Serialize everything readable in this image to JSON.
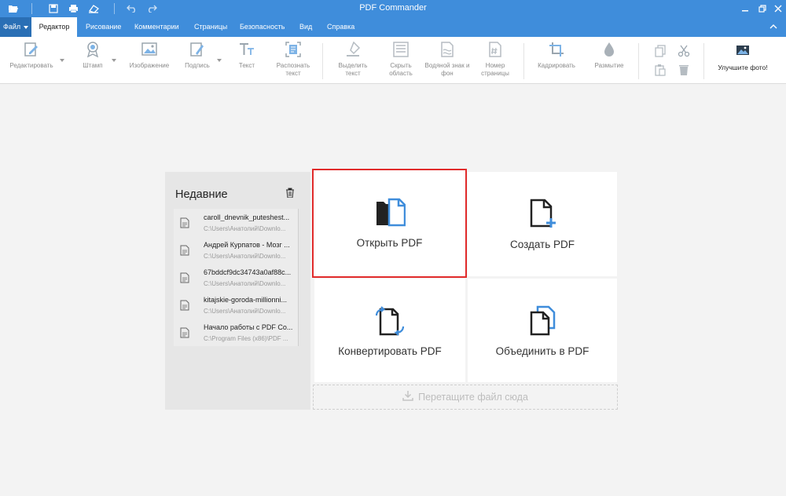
{
  "window": {
    "title": "PDF Commander"
  },
  "menu": {
    "items": [
      {
        "label": "Файл"
      },
      {
        "label": "Редактор"
      },
      {
        "label": "Рисование"
      },
      {
        "label": "Комментарии"
      },
      {
        "label": "Страницы"
      },
      {
        "label": "Безопасность"
      },
      {
        "label": "Вид"
      },
      {
        "label": "Справка"
      }
    ],
    "active": "Редактор"
  },
  "toolbar": {
    "tools": [
      {
        "label": "Редактировать",
        "icon": "edit-icon"
      },
      {
        "label": "Штамп",
        "icon": "stamp-icon"
      },
      {
        "label": "Изображение",
        "icon": "image-icon"
      },
      {
        "label": "Подпись",
        "icon": "signature-icon"
      },
      {
        "label": "Текст",
        "icon": "text-icon"
      },
      {
        "label": "Распознать текст",
        "icon": "ocr-icon"
      },
      {
        "label": "Выделить текст",
        "icon": "highlight-icon"
      },
      {
        "label": "Скрыть область",
        "icon": "hide-area-icon"
      },
      {
        "label": "Водяной знак и фон",
        "icon": "watermark-icon"
      },
      {
        "label": "Номер страницы",
        "icon": "page-number-icon"
      },
      {
        "label": "Кадрировать",
        "icon": "crop-icon"
      },
      {
        "label": "Размытие",
        "icon": "blur-icon"
      }
    ],
    "improve_label": "Улучшите фото!"
  },
  "recent": {
    "title": "Недавние",
    "items": [
      {
        "name": "caroll_dnevnik_puteshest...",
        "path": "C:\\Users\\Анатолий\\Downlo..."
      },
      {
        "name": "Андрей Курпатов - Мозг ...",
        "path": "C:\\Users\\Анатолий\\Downlo..."
      },
      {
        "name": "67bddcf9dc34743a0af88c...",
        "path": "C:\\Users\\Анатолий\\Downlo..."
      },
      {
        "name": "kitajskie-goroda-millionni...",
        "path": "C:\\Users\\Анатолий\\Downlo..."
      },
      {
        "name": "Начало работы с PDF Co...",
        "path": "C:\\Program Files (x86)\\PDF ..."
      }
    ]
  },
  "actions": {
    "open": "Открыть PDF",
    "create": "Создать PDF",
    "convert": "Конвертировать PDF",
    "merge": "Объединить в PDF"
  },
  "dropzone": {
    "label": "Перетащите файл сюда"
  },
  "colors": {
    "accent": "#3f8ddb",
    "highlight": "#e12b2b",
    "icon_blue": "#3f8ddb"
  }
}
